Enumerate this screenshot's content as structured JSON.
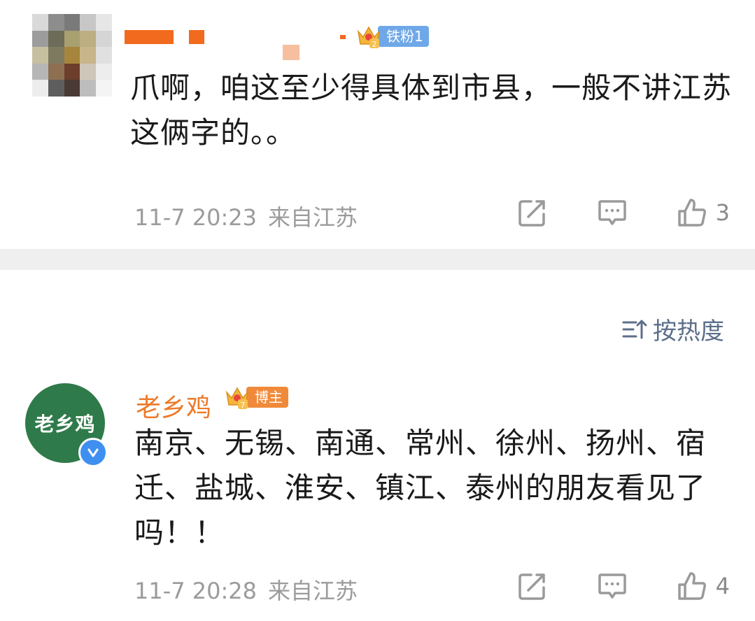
{
  "comments": [
    {
      "badge": "铁粉1",
      "text": "爪啊，咱这至少得具体到市县，一般不讲江苏这俩字的。。",
      "time": "11-7 20:23",
      "location": "来自江苏",
      "likes": "3"
    },
    {
      "username": "老乡鸡",
      "avatar_text": "老乡鸡",
      "badge": "博主",
      "text": "南京、无锡、南通、常州、徐州、扬州、宿迁、盐城、淮安、镇江、泰州的朋友看见了吗！！",
      "time": "11-7 20:28",
      "location": "来自江苏",
      "likes": "4"
    }
  ],
  "sort": {
    "label": "按热度"
  },
  "colors": {
    "badge_fan": "#6fa8e8",
    "badge_author": "#f08a3a",
    "username": "#ec7a2a",
    "avatar_bg": "#2f7a4a",
    "divider": "#efefef"
  },
  "icons": [
    "crown-icon",
    "share-icon",
    "comment-icon",
    "like-icon",
    "sort-icon",
    "verified-icon"
  ]
}
